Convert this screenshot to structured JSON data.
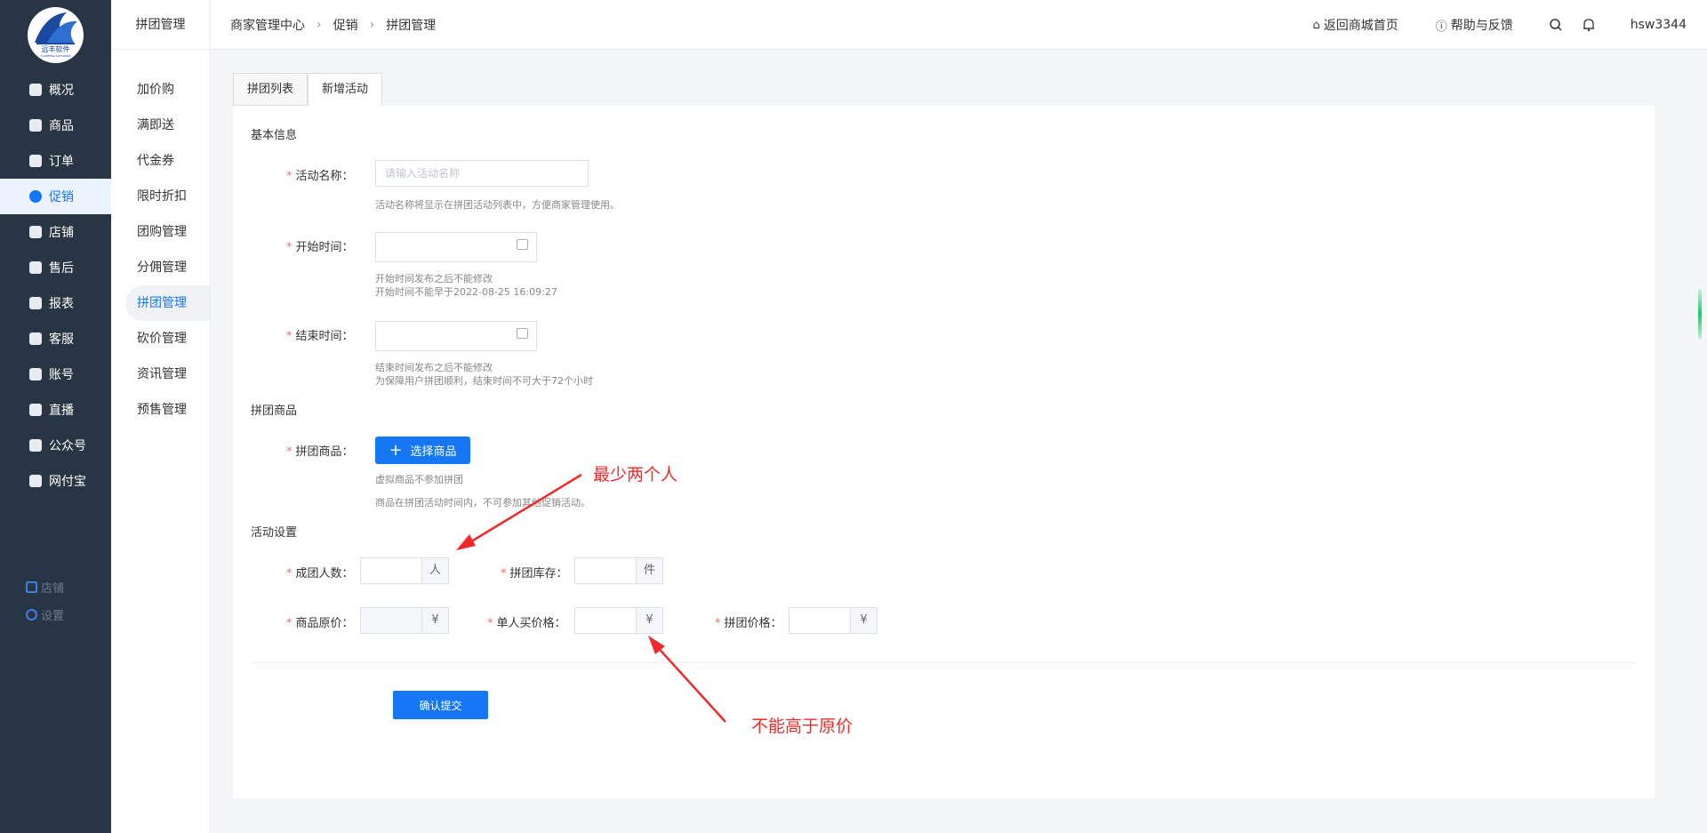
{
  "brand": {
    "logo_text": "远丰软件",
    "logo_subtext": "YUANFENG SOFTWARE"
  },
  "sidebar": {
    "items": [
      {
        "label": "概况",
        "icon": "dashboard-icon"
      },
      {
        "label": "商品",
        "icon": "bag-icon"
      },
      {
        "label": "订单",
        "icon": "bar-chart-icon"
      },
      {
        "label": "促销",
        "icon": "promotion-icon",
        "active": true
      },
      {
        "label": "店铺",
        "icon": "store-icon"
      },
      {
        "label": "售后",
        "icon": "after-sale-icon"
      },
      {
        "label": "报表",
        "icon": "report-icon"
      },
      {
        "label": "客服",
        "icon": "customer-service-icon"
      },
      {
        "label": "账号",
        "icon": "card-icon"
      },
      {
        "label": "直播",
        "icon": "live-icon"
      },
      {
        "label": "公众号",
        "icon": "official-account-icon"
      },
      {
        "label": "网付宝",
        "icon": "shield-icon"
      }
    ],
    "bottom": [
      {
        "label": "店铺",
        "icon": "grid-icon"
      },
      {
        "label": "设置",
        "icon": "settings-icon"
      }
    ]
  },
  "subsidebar": {
    "title": "拼团管理",
    "items": [
      {
        "label": "加价购"
      },
      {
        "label": "满即送"
      },
      {
        "label": "代金券"
      },
      {
        "label": "限时折扣"
      },
      {
        "label": "团购管理"
      },
      {
        "label": "分佣管理"
      },
      {
        "label": "拼团管理",
        "active": true
      },
      {
        "label": "砍价管理"
      },
      {
        "label": "资讯管理"
      },
      {
        "label": "预售管理"
      }
    ]
  },
  "header": {
    "breadcrumb": [
      "商家管理中心",
      "促销",
      "拼团管理"
    ],
    "home_link": "返回商城首页",
    "help_link": "帮助与反馈",
    "username": "hsw3344"
  },
  "tabs": [
    {
      "label": "拼团列表"
    },
    {
      "label": "新增活动",
      "active": true
    }
  ],
  "form": {
    "section_basic": "基本信息",
    "name_label": "活动名称：",
    "name_placeholder": "请输入活动名称",
    "name_hint": "活动名称将显示在拼团活动列表中，方便商家管理使用。",
    "start_label": "开始时间：",
    "start_hint1": "开始时间发布之后不能修改",
    "start_hint2": "开始时间不能早于2022-08-25 16:09:27",
    "end_label": "结束时间：",
    "end_hint1": "结束时间发布之后不能修改",
    "end_hint2": "为保障用户拼团顺利，结束时间不可大于72个小时",
    "section_goods": "拼团商品",
    "goods_label": "拼团商品：",
    "select_button": "选择商品",
    "goods_hint1": "虚拟商品不参加拼团",
    "goods_hint2": "商品在拼团活动时间内，不可参加其他促销活动。",
    "section_settings": "活动设置",
    "group_size_label": "成团人数：",
    "group_size_unit": "人",
    "stock_label": "拼团库存：",
    "stock_unit": "件",
    "orig_price_label": "商品原价：",
    "orig_price_unit": "¥",
    "single_price_label": "单人买价格：",
    "single_price_unit": "¥",
    "group_price_label": "拼团价格：",
    "group_price_unit": "¥",
    "submit_button": "确认提交"
  },
  "annotations": {
    "note1": "最少两个人",
    "note2": "不能高于原价",
    "color": "#f02a2a"
  }
}
